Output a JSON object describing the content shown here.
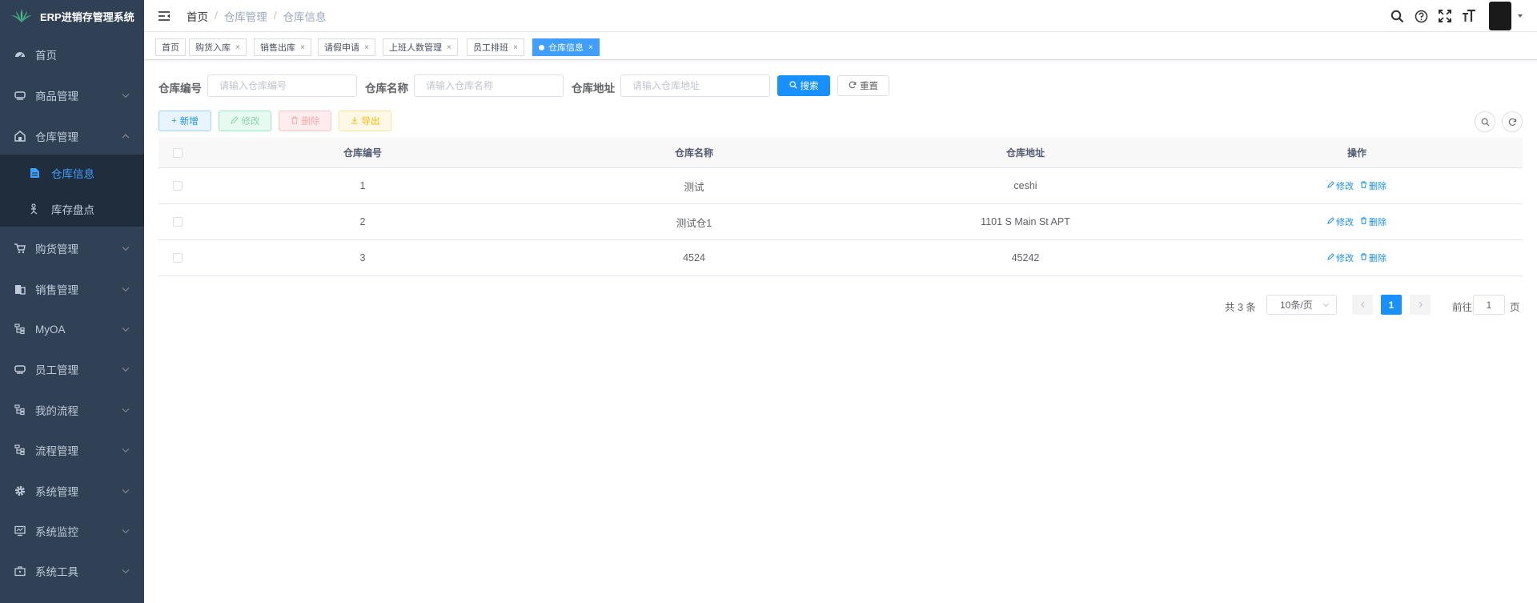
{
  "app": {
    "title": "ERP进销存管理系统"
  },
  "sidebar": {
    "items": [
      {
        "label": "首页",
        "icon": "dashboard-icon"
      },
      {
        "label": "商品管理",
        "icon": "goods-icon"
      },
      {
        "label": "仓库管理",
        "icon": "warehouse-icon"
      },
      {
        "label": "购货管理",
        "icon": "cart-icon"
      },
      {
        "label": "销售管理",
        "icon": "sales-icon"
      },
      {
        "label": "MyOA",
        "icon": "tree-icon"
      },
      {
        "label": "员工管理",
        "icon": "employee-icon"
      },
      {
        "label": "我的流程",
        "icon": "tree-icon"
      },
      {
        "label": "流程管理",
        "icon": "tree-icon"
      },
      {
        "label": "系统管理",
        "icon": "gear-icon"
      },
      {
        "label": "系统监控",
        "icon": "monitor-icon"
      },
      {
        "label": "系统工具",
        "icon": "toolbox-icon"
      }
    ],
    "submenu": [
      {
        "label": "仓库信息",
        "icon": "document-icon",
        "active": true
      },
      {
        "label": "库存盘点",
        "icon": "person-icon",
        "active": false
      }
    ],
    "colors": {
      "background": "#304156",
      "submenu_background": "#1f2d3d",
      "active": "#409eff"
    }
  },
  "header": {
    "breadcrumb": [
      "首页",
      "仓库管理",
      "仓库信息"
    ],
    "breadcrumb_separator": "/"
  },
  "tags": [
    {
      "label": "首页",
      "closable": false,
      "active": false
    },
    {
      "label": "购货入库",
      "closable": true,
      "active": false
    },
    {
      "label": "销售出库",
      "closable": true,
      "active": false
    },
    {
      "label": "请假申请",
      "closable": true,
      "active": false
    },
    {
      "label": "上班人数管理",
      "closable": true,
      "active": false
    },
    {
      "label": "员工排班",
      "closable": true,
      "active": false
    },
    {
      "label": "仓库信息",
      "closable": true,
      "active": true
    }
  ],
  "tag_close_symbol": "×",
  "search": {
    "fields": [
      {
        "label": "仓库编号",
        "placeholder": "请输入仓库编号",
        "value": ""
      },
      {
        "label": "仓库名称",
        "placeholder": "请输入仓库名称",
        "value": ""
      },
      {
        "label": "仓库地址",
        "placeholder": "请输入仓库地址",
        "value": ""
      }
    ],
    "search_label": "搜索",
    "reset_label": "重置"
  },
  "toolbar": {
    "add_label": "新增",
    "edit_label": "修改",
    "delete_label": "删除",
    "export_label": "导出"
  },
  "table": {
    "columns": [
      "仓库编号",
      "仓库名称",
      "仓库地址",
      "操作"
    ],
    "rows": [
      {
        "id": "1",
        "name": "测试",
        "address": "ceshi"
      },
      {
        "id": "2",
        "name": "测试仓1",
        "address": "1101 S Main St APT"
      },
      {
        "id": "3",
        "name": "4524",
        "address": "45242"
      }
    ],
    "row_actions": {
      "edit": "修改",
      "delete": "删除"
    }
  },
  "pagination": {
    "total_text": "共 3 条",
    "page_size": "10条/页",
    "current_page": "1",
    "goto_prefix": "前往",
    "goto_value": "1",
    "goto_suffix": "页"
  }
}
